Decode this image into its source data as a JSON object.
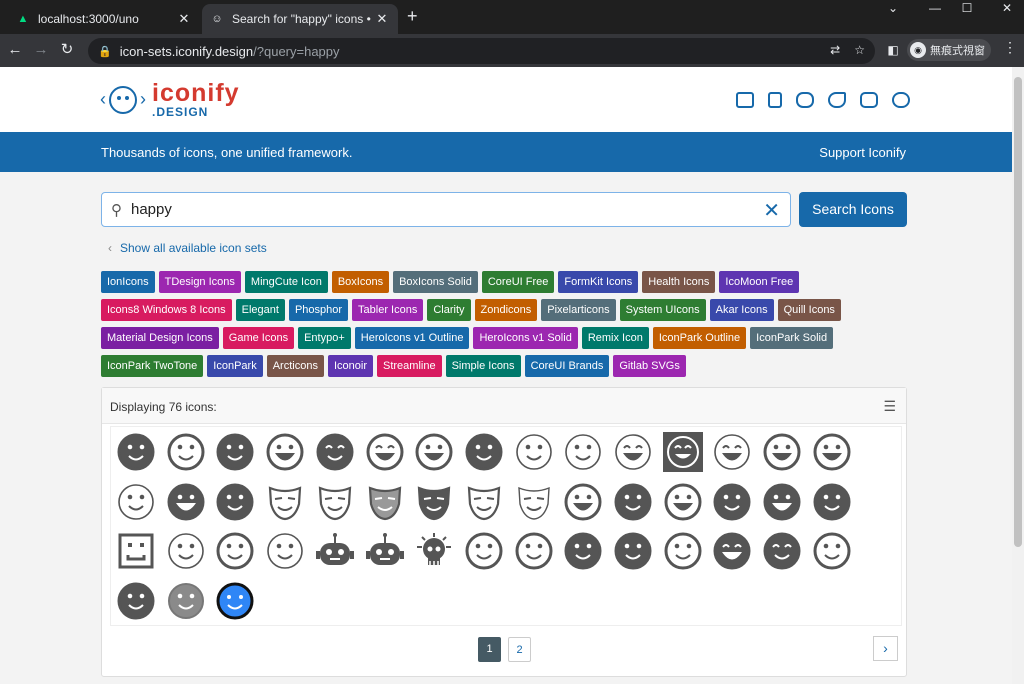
{
  "browser": {
    "tabs": [
      {
        "title": "localhost:3000/uno",
        "favicon": "nuxt-icon"
      },
      {
        "title": "Search for \"happy\" icons • Icor",
        "favicon": "smile-icon"
      }
    ],
    "url_host": "icon-sets.iconify.design",
    "url_path": "/?query=happy",
    "profile": "無痕式視窗"
  },
  "header": {
    "logo_main": "iconify",
    "logo_sub": ".DESIGN",
    "tagline": "Thousands of icons, one unified framework.",
    "support": "Support Iconify"
  },
  "search": {
    "query": "happy",
    "button": "Search Icons",
    "show_all": "Show all available icon sets"
  },
  "icon_sets": [
    {
      "name": "IonIcons",
      "color": "#1769aa"
    },
    {
      "name": "TDesign Icons",
      "color": "#9c27b0"
    },
    {
      "name": "MingCute Icon",
      "color": "#00796b"
    },
    {
      "name": "BoxIcons",
      "color": "#c25e00"
    },
    {
      "name": "BoxIcons Solid",
      "color": "#546e7a"
    },
    {
      "name": "CoreUI Free",
      "color": "#2e7d32"
    },
    {
      "name": "FormKit Icons",
      "color": "#3949ab"
    },
    {
      "name": "Health Icons",
      "color": "#795548"
    },
    {
      "name": "IcoMoon Free",
      "color": "#5e35b1"
    },
    {
      "name": "Icons8 Windows 8 Icons",
      "color": "#d81b60"
    },
    {
      "name": "Elegant",
      "color": "#00796b"
    },
    {
      "name": "Phosphor",
      "color": "#1769aa"
    },
    {
      "name": "Tabler Icons",
      "color": "#9c27b0"
    },
    {
      "name": "Clarity",
      "color": "#2e7d32"
    },
    {
      "name": "Zondicons",
      "color": "#c25e00"
    },
    {
      "name": "Pixelarticons",
      "color": "#546e7a"
    },
    {
      "name": "System UIcons",
      "color": "#2e7d32"
    },
    {
      "name": "Akar Icons",
      "color": "#3949ab"
    },
    {
      "name": "Quill Icons",
      "color": "#795548"
    },
    {
      "name": "Material Design Icons",
      "color": "#7b1fa2"
    },
    {
      "name": "Game Icons",
      "color": "#d81b60"
    },
    {
      "name": "Entypo+",
      "color": "#00796b"
    },
    {
      "name": "HeroIcons v1 Outline",
      "color": "#1769aa"
    },
    {
      "name": "HeroIcons v1 Solid",
      "color": "#9c27b0"
    },
    {
      "name": "Remix Icon",
      "color": "#00796b"
    },
    {
      "name": "IconPark Outline",
      "color": "#c25e00"
    },
    {
      "name": "IconPark Solid",
      "color": "#546e7a"
    },
    {
      "name": "IconPark TwoTone",
      "color": "#2e7d32"
    },
    {
      "name": "IconPark",
      "color": "#3949ab"
    },
    {
      "name": "Arcticons",
      "color": "#795548"
    },
    {
      "name": "Iconoir",
      "color": "#5e35b1"
    },
    {
      "name": "Streamline",
      "color": "#d81b60"
    },
    {
      "name": "Simple Icons",
      "color": "#00796b"
    },
    {
      "name": "CoreUI Brands",
      "color": "#1769aa"
    },
    {
      "name": "Gitlab SVGs",
      "color": "#9c27b0"
    }
  ],
  "results": {
    "count_text": "Displaying 76 icons:",
    "pages": [
      "1",
      "2"
    ],
    "icons": [
      "filled",
      "outline",
      "filled",
      "outline-grin",
      "filled-wink",
      "outline-laugh",
      "outline-grin",
      "filled",
      "outline-thin",
      "outline-thin",
      "outline-laugh-thin",
      "boxed-laugh",
      "outline-laugh-thin",
      "outline-bigsmile",
      "outline-bigsmile",
      "outline-thin",
      "filled-grin",
      "filled",
      "mask-outline",
      "mask-outline",
      "mask-gray",
      "mask-filled",
      "mask-outline",
      "mask-thin",
      "outline-grin",
      "filled",
      "outline-grin",
      "filled",
      "filled-grin",
      "filled",
      "pixel",
      "outline-thin",
      "outline",
      "outline-thin",
      "robot",
      "robot",
      "skull",
      "outline",
      "outline",
      "filled",
      "filled",
      "outline",
      "filled-laugh",
      "filled-wink",
      "outline",
      "filled",
      "gray",
      "blue"
    ]
  }
}
